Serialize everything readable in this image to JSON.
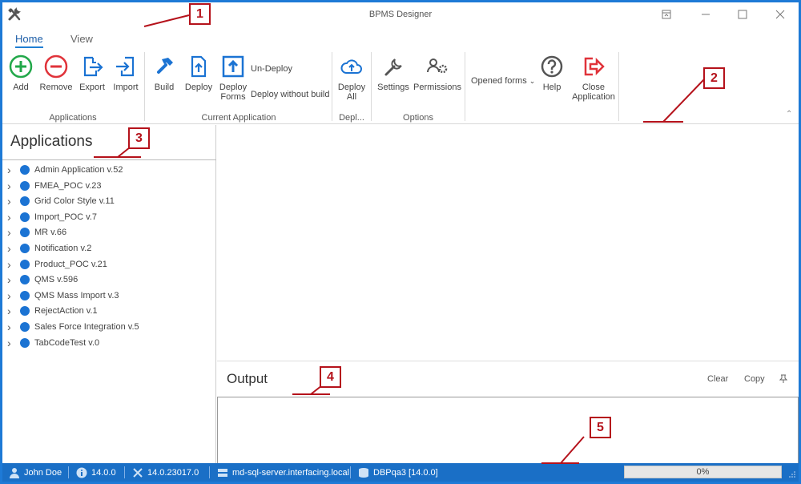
{
  "window": {
    "title": "BPMS Designer"
  },
  "tabs": [
    {
      "label": "Home",
      "active": true
    },
    {
      "label": "View",
      "active": false
    }
  ],
  "ribbon": {
    "applications": {
      "label": "Applications",
      "add": "Add",
      "remove": "Remove",
      "export": "Export",
      "import": "Import"
    },
    "current_application": {
      "label": "Current Application",
      "build": "Build",
      "deploy": "Deploy",
      "deploy_forms": "Deploy\nForms",
      "undeploy": "Un-Deploy",
      "deploy_without_build": "Deploy without build"
    },
    "deploy_group": {
      "label": "Depl...",
      "deploy_all": "Deploy\nAll"
    },
    "options": {
      "label": "Options",
      "settings": "Settings",
      "permissions": "Permissions"
    },
    "opened_forms": "Opened forms",
    "help": "Help",
    "close_application": "Close\nApplication"
  },
  "left_panel": {
    "title": "Applications",
    "items": [
      "Admin Application v.52",
      "FMEA_POC v.23",
      "Grid Color Style v.11",
      "Import_POC v.7",
      "MR v.66",
      "Notification v.2",
      "Product_POC v.21",
      "QMS v.596",
      "QMS Mass Import v.3",
      "RejectAction v.1",
      "Sales Force Integration v.5",
      "TabCodeTest v.0"
    ]
  },
  "output": {
    "title": "Output",
    "clear": "Clear",
    "copy": "Copy"
  },
  "status": {
    "user": "John Doe",
    "version": "14.0.0",
    "build": "14.0.23017.0",
    "server": "md-sql-server.interfacing.local",
    "database": "DBPqa3 [14.0.0]",
    "progress": "0%",
    "progress_value": 0
  },
  "callouts": [
    "1",
    "2",
    "3",
    "4",
    "5"
  ],
  "colors": {
    "accent": "#1e7ad6",
    "status_bar": "#1a6fc6",
    "add_green": "#22a84a",
    "remove_red": "#e0333a",
    "callout_red": "#b5121b"
  }
}
